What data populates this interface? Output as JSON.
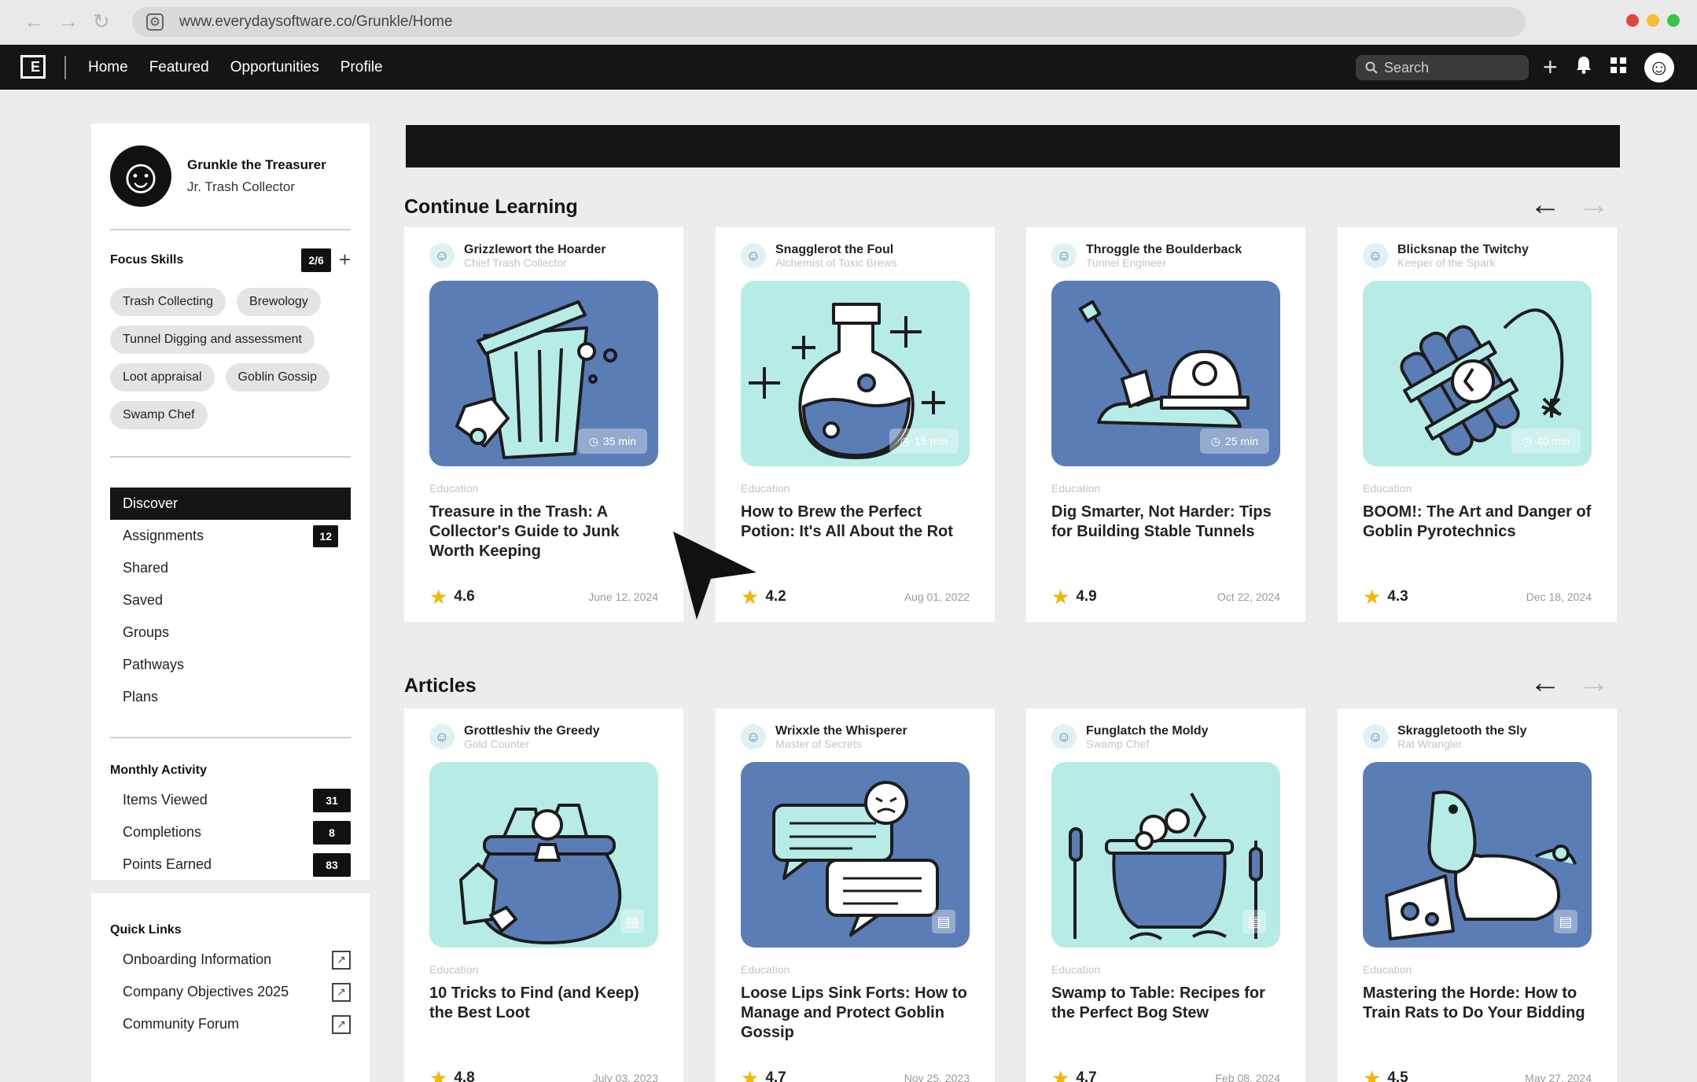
{
  "browser": {
    "url": "www.everydaysoftware.co/Grunkle/Home",
    "back_icon": "←",
    "forward_icon": "→",
    "reload_icon": "↻",
    "traffic_colors": [
      "#e0443e",
      "#f5bf2f",
      "#3bc449"
    ]
  },
  "appbar": {
    "logo_glyph": "E",
    "nav": [
      "Home",
      "Featured",
      "Opportunities",
      "Profile"
    ],
    "search_placeholder": "Search",
    "plus_glyph": "+",
    "bell_glyph": "🔔",
    "grid_glyph": "▦",
    "avatar_glyph": "☺"
  },
  "profile": {
    "name": "Grunkle the Treasurer",
    "role": "Jr. Trash Collector",
    "avatar_glyph": "☺"
  },
  "focus_skills": {
    "title": "Focus Skills",
    "count": "2/6",
    "plus_glyph": "+",
    "chips": [
      "Trash Collecting",
      "Brewology",
      "Tunnel Digging and assessment",
      "Loot appraisal",
      "Goblin Gossip",
      "Swamp Chef"
    ]
  },
  "menu": [
    {
      "label": "Discover",
      "badge": ""
    },
    {
      "label": "Assignments",
      "badge": "12"
    },
    {
      "label": "Shared",
      "badge": ""
    },
    {
      "label": "Saved",
      "badge": ""
    },
    {
      "label": "Groups",
      "badge": ""
    },
    {
      "label": "Pathways",
      "badge": ""
    },
    {
      "label": "Plans",
      "badge": ""
    }
  ],
  "activity": {
    "title": "Monthly Activity",
    "rows": [
      {
        "label": "Items Viewed",
        "value": "31"
      },
      {
        "label": "Completions",
        "value": "8"
      },
      {
        "label": "Points Earned",
        "value": "83"
      }
    ]
  },
  "quick_links": {
    "title": "Quick Links",
    "items": [
      "Onboarding Information",
      "Company Objectives 2025",
      "Community Forum"
    ],
    "ext_glyph": "↗"
  },
  "sections": {
    "continue": "Continue Learning",
    "articles": "Articles",
    "prev_glyph": "←",
    "next_glyph": "→"
  },
  "continue_cards": [
    {
      "author": "Grizzlewort the Hoarder",
      "role": "Chief Trash Collector",
      "category": "Education",
      "title": "Treasure in the Trash: A Collector's Guide to Junk Worth Keeping",
      "rating": "4.6",
      "date": "June 12, 2024",
      "duration": "35 min",
      "thumb": "blue",
      "art": "trash-can"
    },
    {
      "author": "Snagglerot the Foul",
      "role": "Alchemist of Toxic Brews",
      "category": "Education",
      "title": "How to Brew the Perfect Potion: It's All About the Rot",
      "rating": "4.2",
      "date": "Aug 01, 2022",
      "duration": "15 min",
      "thumb": "teal",
      "art": "potion"
    },
    {
      "author": "Throggle the Boulderback",
      "role": "Tunnel Engineer",
      "category": "Education",
      "title": "Dig Smarter, Not Harder: Tips for Building Stable Tunnels",
      "rating": "4.9",
      "date": "Oct 22, 2024",
      "duration": "25 min",
      "thumb": "blue",
      "art": "shovel"
    },
    {
      "author": "Blicksnap the Twitchy",
      "role": "Keeper of the Spark",
      "category": "Education",
      "title": "BOOM!: The Art and Danger of Goblin Pyrotechnics",
      "rating": "4.3",
      "date": "Dec 18, 2024",
      "duration": "40 min",
      "thumb": "teal",
      "art": "dynamite"
    }
  ],
  "article_cards": [
    {
      "author": "Grottleshiv the Greedy",
      "role": "Gold Counter",
      "category": "Education",
      "title": "10 Tricks to Find (and Keep) the Best Loot",
      "rating": "4.8",
      "date": "July 03, 2023",
      "thumb": "teal",
      "art": "loot-bag"
    },
    {
      "author": "Wrixxle the Whisperer",
      "role": "Master of Secrets",
      "category": "Education",
      "title": "Loose Lips Sink Forts: How to Manage and Protect Goblin Gossip",
      "rating": "4.7",
      "date": "Nov 25, 2023",
      "thumb": "blue",
      "art": "speech"
    },
    {
      "author": "Funglatch the Moldy",
      "role": "Swamp Chef",
      "category": "Education",
      "title": "Swamp to Table: Recipes for the Perfect Bog Stew",
      "rating": "4.7",
      "date": "Feb 08, 2024",
      "thumb": "teal",
      "art": "cauldron"
    },
    {
      "author": "Skraggletooth the Sly",
      "role": "Rat Wrangler",
      "category": "Education",
      "title": "Mastering the Horde: How to Train Rats to Do Your Bidding",
      "rating": "4.5",
      "date": "May 27, 2024",
      "thumb": "blue",
      "art": "rat-cheese"
    }
  ],
  "icons": {
    "star": "★",
    "clock": "◷",
    "doc": "▤",
    "search": "⌕"
  },
  "colors": {
    "dark": "#151515",
    "thumb_blue": "#5b7db6",
    "thumb_teal": "#b6ece5",
    "star": "#f2b705"
  }
}
